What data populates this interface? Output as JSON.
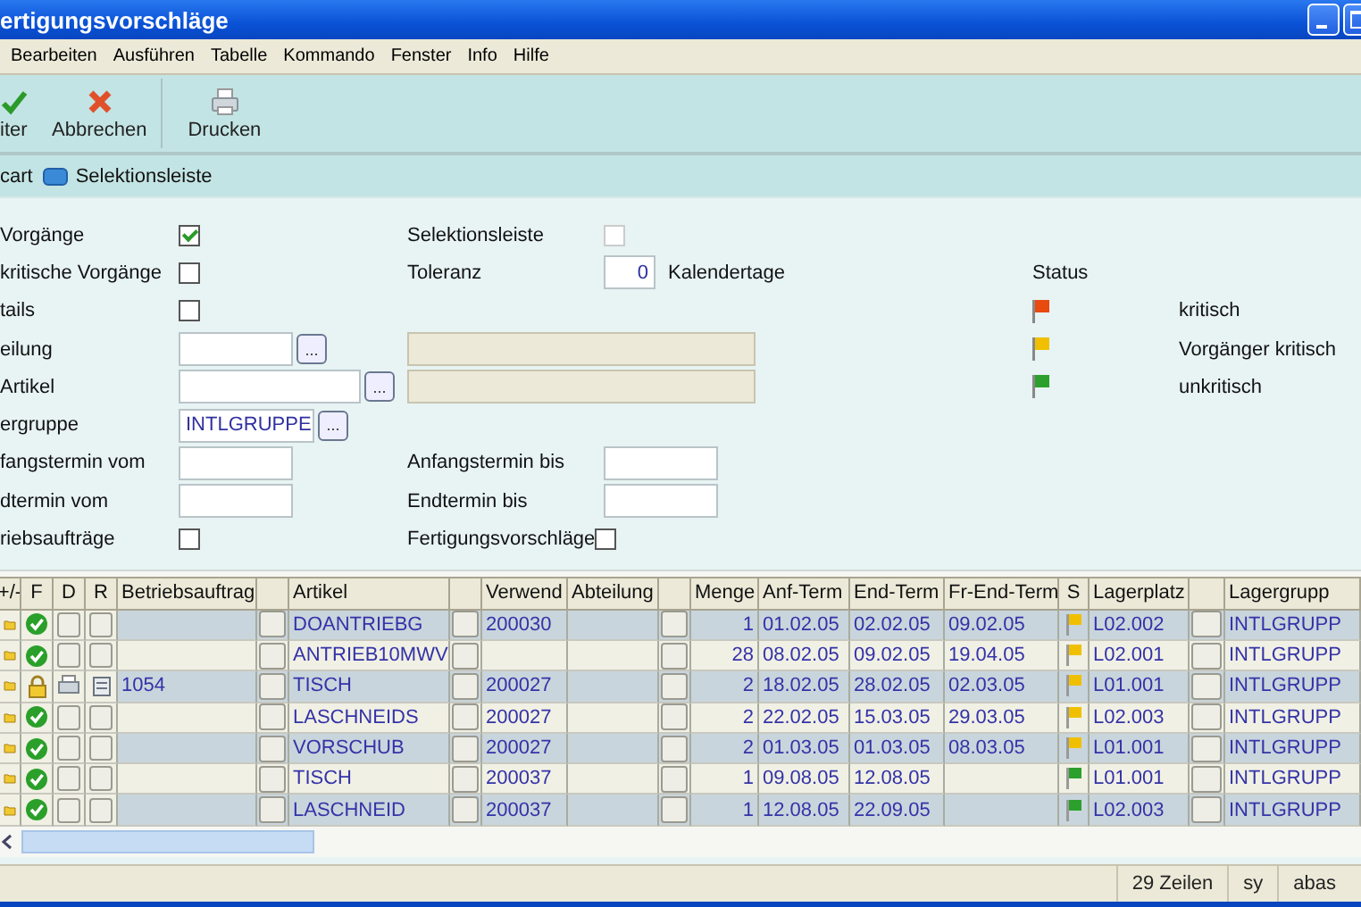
{
  "window": {
    "title": "ertigungsvorschläge"
  },
  "menu": [
    "Bearbeiten",
    "Ausführen",
    "Tabelle",
    "Kommando",
    "Fenster",
    "Info",
    "Hilfe"
  ],
  "toolbar": [
    {
      "label": "iter",
      "kind": "check"
    },
    {
      "label": "Abbrechen",
      "kind": "cross"
    },
    {
      "label": "Drucken",
      "kind": "printer"
    }
  ],
  "tabs": [
    {
      "label": "cart",
      "icon": false
    },
    {
      "label": "Selektionsleiste",
      "icon": true
    }
  ],
  "form": {
    "rows": [
      {
        "left": {
          "label": "Vorgänge",
          "kind": "checkbox",
          "checked": true
        },
        "right": {
          "label": "Selektionsleiste",
          "kind": "checkbox",
          "checked": false
        }
      },
      {
        "left": {
          "label": "kritische Vorgänge",
          "kind": "checkbox",
          "checked": false
        },
        "right": {
          "label": "Toleranz",
          "kind": "number",
          "value": "0",
          "unit": "Kalendertage"
        }
      },
      {
        "left": {
          "label": "tails",
          "kind": "checkbox",
          "checked": false
        }
      },
      {
        "left": {
          "label": "eilung",
          "kind": "lookup",
          "button": "..."
        },
        "right": {
          "kind": "display"
        }
      },
      {
        "left": {
          "label": "Artikel",
          "kind": "lookup",
          "button": "..."
        },
        "right": {
          "kind": "display"
        }
      },
      {
        "left": {
          "label": "ergruppe",
          "kind": "lookup",
          "value": "INTLGRUPPE",
          "button": "..."
        }
      },
      {
        "left": {
          "label": "fangstermin vom",
          "kind": "text"
        },
        "right": {
          "label": "Anfangstermin bis",
          "kind": "text"
        }
      },
      {
        "left": {
          "label": "dtermin vom",
          "kind": "text"
        },
        "right": {
          "label": "Endtermin bis",
          "kind": "text"
        }
      },
      {
        "left": {
          "label": "riebsaufträge",
          "kind": "checkbox",
          "checked": false
        },
        "right": {
          "label": "Fertigungsvorschläge",
          "kind": "checkbox",
          "checked": false
        }
      }
    ],
    "status_legend": {
      "title": "Status",
      "items": [
        {
          "label": "kritisch",
          "color": "#e84a10"
        },
        {
          "label": "Vorgänger kritisch",
          "color": "#f0c000"
        },
        {
          "label": "unkritisch",
          "color": "#2ca02c"
        }
      ]
    }
  },
  "table": {
    "columns": [
      {
        "label": "+/-"
      },
      {
        "label": "F"
      },
      {
        "label": "D"
      },
      {
        "label": "R"
      },
      {
        "label": "Betriebsauftrag"
      },
      {
        "kind": "button"
      },
      {
        "label": "Artikel"
      },
      {
        "kind": "button"
      },
      {
        "label": "Verwend"
      },
      {
        "label": "Abteilung"
      },
      {
        "kind": "button"
      },
      {
        "label": "Menge"
      },
      {
        "label": "Anf-Term"
      },
      {
        "label": "End-Term"
      },
      {
        "label": "Fr-End-Term"
      },
      {
        "label": "S"
      },
      {
        "label": "Lagerplatz"
      },
      {
        "kind": "button"
      },
      {
        "label": "Lagergrupp"
      }
    ],
    "rows": [
      {
        "kind": "check",
        "documents": false,
        "artikel": "DOANTRIEBG",
        "verwend": "200030",
        "menge": "1",
        "anf_term": "01.02.05",
        "end_term": "02.02.05",
        "fr_end_term": "09.02.05",
        "color": "#f0c000",
        "lagerplatz": "L02.002",
        "lagergruppe": "INTLGRUPP"
      },
      {
        "kind": "check",
        "documents": false,
        "artikel": "ANTRIEB10MWV",
        "menge": "28",
        "anf_term": "08.02.05",
        "end_term": "09.02.05",
        "fr_end_term": "19.04.05",
        "color": "#f0c000",
        "lagerplatz": "L02.001",
        "lagergruppe": "INTLGRUPP"
      },
      {
        "kind": "lock",
        "documents": true,
        "betriebsauftrag": "1054",
        "artikel": "TISCH",
        "verwend": "200027",
        "menge": "2",
        "anf_term": "18.02.05",
        "end_term": "28.02.05",
        "fr_end_term": "02.03.05",
        "color": "#f0c000",
        "lagerplatz": "L01.001",
        "lagergruppe": "INTLGRUPP"
      },
      {
        "kind": "check",
        "documents": false,
        "artikel": "LASCHNEIDS",
        "verwend": "200027",
        "menge": "2",
        "anf_term": "22.02.05",
        "end_term": "15.03.05",
        "fr_end_term": "29.03.05",
        "color": "#f0c000",
        "lagerplatz": "L02.003",
        "lagergruppe": "INTLGRUPP"
      },
      {
        "kind": "check",
        "documents": false,
        "artikel": "VORSCHUB",
        "verwend": "200027",
        "menge": "2",
        "anf_term": "01.03.05",
        "end_term": "01.03.05",
        "fr_end_term": "08.03.05",
        "color": "#f0c000",
        "lagerplatz": "L01.001",
        "lagergruppe": "INTLGRUPP"
      },
      {
        "kind": "check",
        "documents": false,
        "artikel": "TISCH",
        "verwend": "200037",
        "menge": "1",
        "anf_term": "09.08.05",
        "end_term": "12.08.05",
        "color": "#2ca02c",
        "lagerplatz": "L01.001",
        "lagergruppe": "INTLGRUPP"
      },
      {
        "kind": "check",
        "documents": false,
        "artikel": "LASCHNEID",
        "verwend": "200037",
        "menge": "1",
        "anf_term": "12.08.05",
        "end_term": "22.09.05",
        "color": "#2ca02c",
        "lagerplatz": "L02.003",
        "lagergruppe": "INTLGRUPP"
      }
    ]
  },
  "status_bar": [
    "29 Zeilen",
    "sy",
    "abas"
  ]
}
